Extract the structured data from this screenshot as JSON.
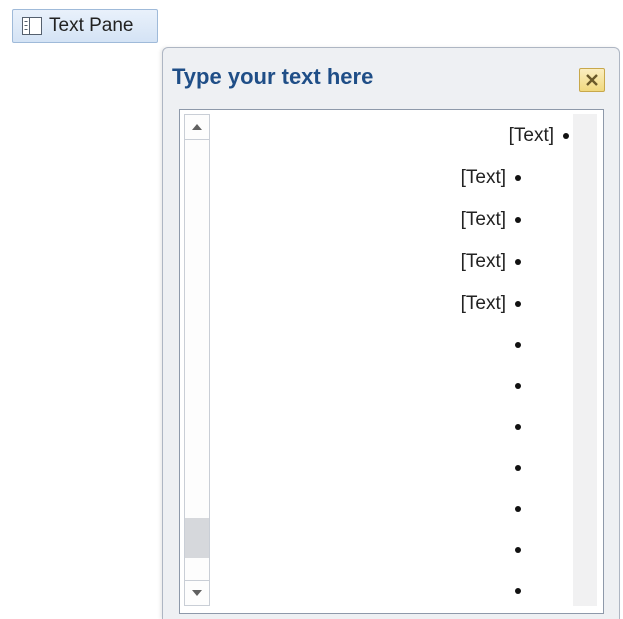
{
  "toggle": {
    "label": "Text Pane",
    "icon": "text-pane-icon"
  },
  "pane": {
    "title": "Type your text here",
    "close_icon": "close-icon",
    "items": [
      {
        "text": "[Text]",
        "level": 1
      },
      {
        "text": "[Text]",
        "level": 2
      },
      {
        "text": "[Text]",
        "level": 2
      },
      {
        "text": "[Text]",
        "level": 2
      },
      {
        "text": "[Text]",
        "level": 2
      },
      {
        "text": "",
        "level": 2
      },
      {
        "text": "",
        "level": 2
      },
      {
        "text": "",
        "level": 2
      },
      {
        "text": "",
        "level": 2
      },
      {
        "text": "",
        "level": 2
      },
      {
        "text": "",
        "level": 2
      },
      {
        "text": "",
        "level": 2
      }
    ]
  }
}
